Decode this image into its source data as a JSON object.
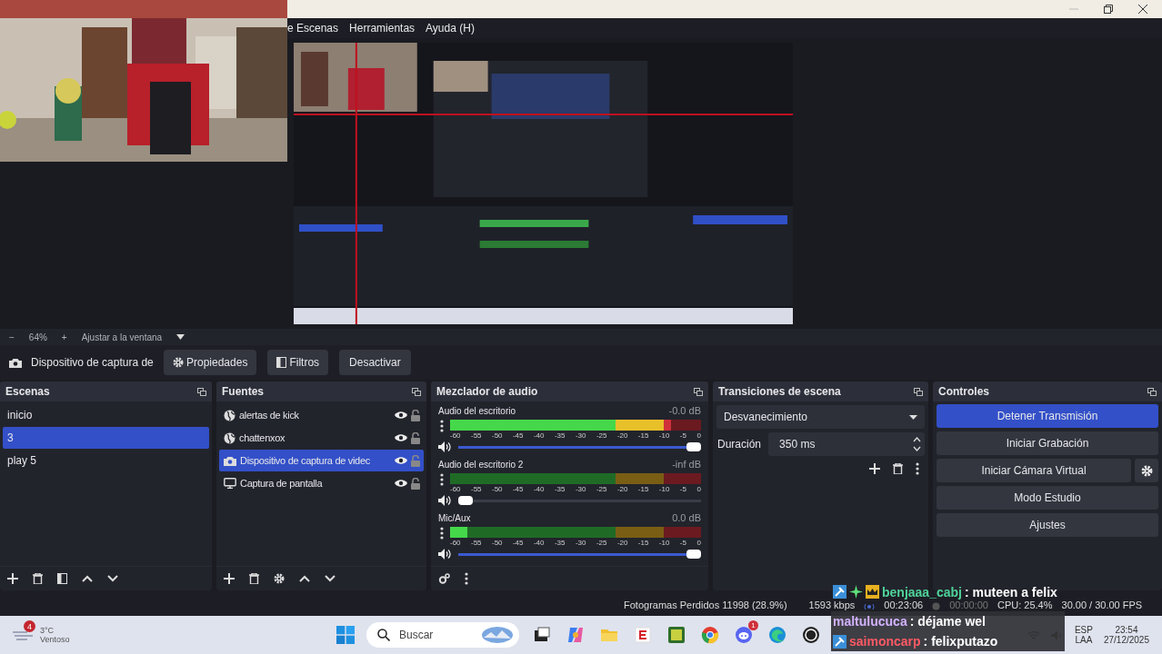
{
  "menu": [
    "e Escenas",
    "Herramientas",
    "Ayuda (H)"
  ],
  "zoom_bar": {
    "minus": "−",
    "zoom": "64%",
    "plus": "+",
    "fit": "Ajustar a la ventana"
  },
  "source_toolbar": {
    "source": "Dispositivo de captura de",
    "buttons": [
      {
        "label": "Propiedades"
      },
      {
        "label": "Filtros"
      },
      {
        "label": "Desactivar"
      }
    ]
  },
  "scenes": {
    "title": "Escenas",
    "items": [
      {
        "label": "inicio",
        "selected": false
      },
      {
        "label": "3",
        "selected": true
      },
      {
        "label": "play 5",
        "selected": false
      }
    ]
  },
  "sources": {
    "title": "Fuentes",
    "items": [
      {
        "kind": "browser",
        "label": "alertas de kick",
        "selected": false,
        "visible": true
      },
      {
        "kind": "browser",
        "label": "chattenxox",
        "selected": false,
        "visible": true
      },
      {
        "kind": "camera",
        "label": "Dispositivo de captura de videc",
        "selected": true,
        "visible": true
      },
      {
        "kind": "display",
        "label": "Captura de pantalla",
        "selected": false,
        "visible": true
      }
    ]
  },
  "mixer": {
    "title": "Mezclador de audio",
    "channels": [
      {
        "name": "Audio del escritorio",
        "db": "-0.0 dB",
        "meter": {
          "level": 0.88
        },
        "volume": {
          "level": 1.0
        },
        "scale": [
          "-60",
          "-55",
          "-50",
          "-45",
          "-40",
          "-35",
          "-30",
          "-25",
          "-20",
          "-15",
          "-10",
          "-5",
          "0"
        ]
      },
      {
        "name": "Audio del escritorio 2",
        "db": "-inf dB",
        "meter": {
          "level": 0.0
        },
        "volume": {
          "level": 0.0
        },
        "scale": [
          "-60",
          "-55",
          "-50",
          "-45",
          "-40",
          "-35",
          "-30",
          "-25",
          "-20",
          "-15",
          "-10",
          "-5",
          "0"
        ]
      },
      {
        "name": "Mic/Aux",
        "db": "0.0 dB",
        "meter": {
          "level": 0.07
        },
        "volume": {
          "level": 1.0
        },
        "scale": [
          "-60",
          "-55",
          "-50",
          "-45",
          "-40",
          "-35",
          "-30",
          "-25",
          "-20",
          "-15",
          "-10",
          "-5",
          "0"
        ]
      }
    ]
  },
  "transitions": {
    "title": "Transiciones de escena",
    "type": "Desvanecimiento",
    "duration_label": "Duración",
    "duration": "350 ms"
  },
  "controls": {
    "title": "Controles",
    "buttons": [
      {
        "label": "Detener Transmisión",
        "active": true,
        "settings": false
      },
      {
        "label": "Iniciar Grabación",
        "active": false,
        "settings": false
      },
      {
        "label": "Iniciar Cámara Virtual",
        "active": false,
        "settings": true
      },
      {
        "label": "Modo Estudio",
        "active": false,
        "settings": false
      },
      {
        "label": "Ajustes",
        "active": false,
        "settings": false
      }
    ]
  },
  "status_bar": {
    "dropped": "Fotogramas Perdidos 11998 (28.9%)",
    "bitrate": "1593 kbps",
    "stream_time": "00:23:06",
    "rec_time": "00:00:00",
    "cpu": "CPU: 25.4%",
    "fps": "30.00 / 30.00 FPS"
  },
  "chat": [
    {
      "kind": "vip",
      "user": "benjaaa_cabj",
      "color": "#4fd39a",
      "message": ": muteen a felix"
    },
    {
      "kind": "plain",
      "user": "maltulucuca",
      "color": "#d2b2ff",
      "message": ": déjame wel"
    },
    {
      "kind": "mod",
      "user": "saimoncarp",
      "color": "#ff5a64",
      "message": ": felixputazo"
    }
  ],
  "taskbar": {
    "weather": {
      "badge": "4",
      "temp": "3°C",
      "condition": "Ventoso"
    },
    "search": {
      "placeholder": "Buscar"
    },
    "apps": [
      {
        "kind": "taskview"
      },
      {
        "kind": "copilot"
      },
      {
        "kind": "folder"
      },
      {
        "kind": "news"
      },
      {
        "kind": "game"
      },
      {
        "kind": "chrome"
      },
      {
        "kind": "discord",
        "badge": "1"
      },
      {
        "kind": "edge"
      },
      {
        "kind": "obs"
      }
    ],
    "tray": {
      "lang": "ESP",
      "layout": "LAA",
      "time": "23:54",
      "date": "27/12/2025"
    }
  }
}
